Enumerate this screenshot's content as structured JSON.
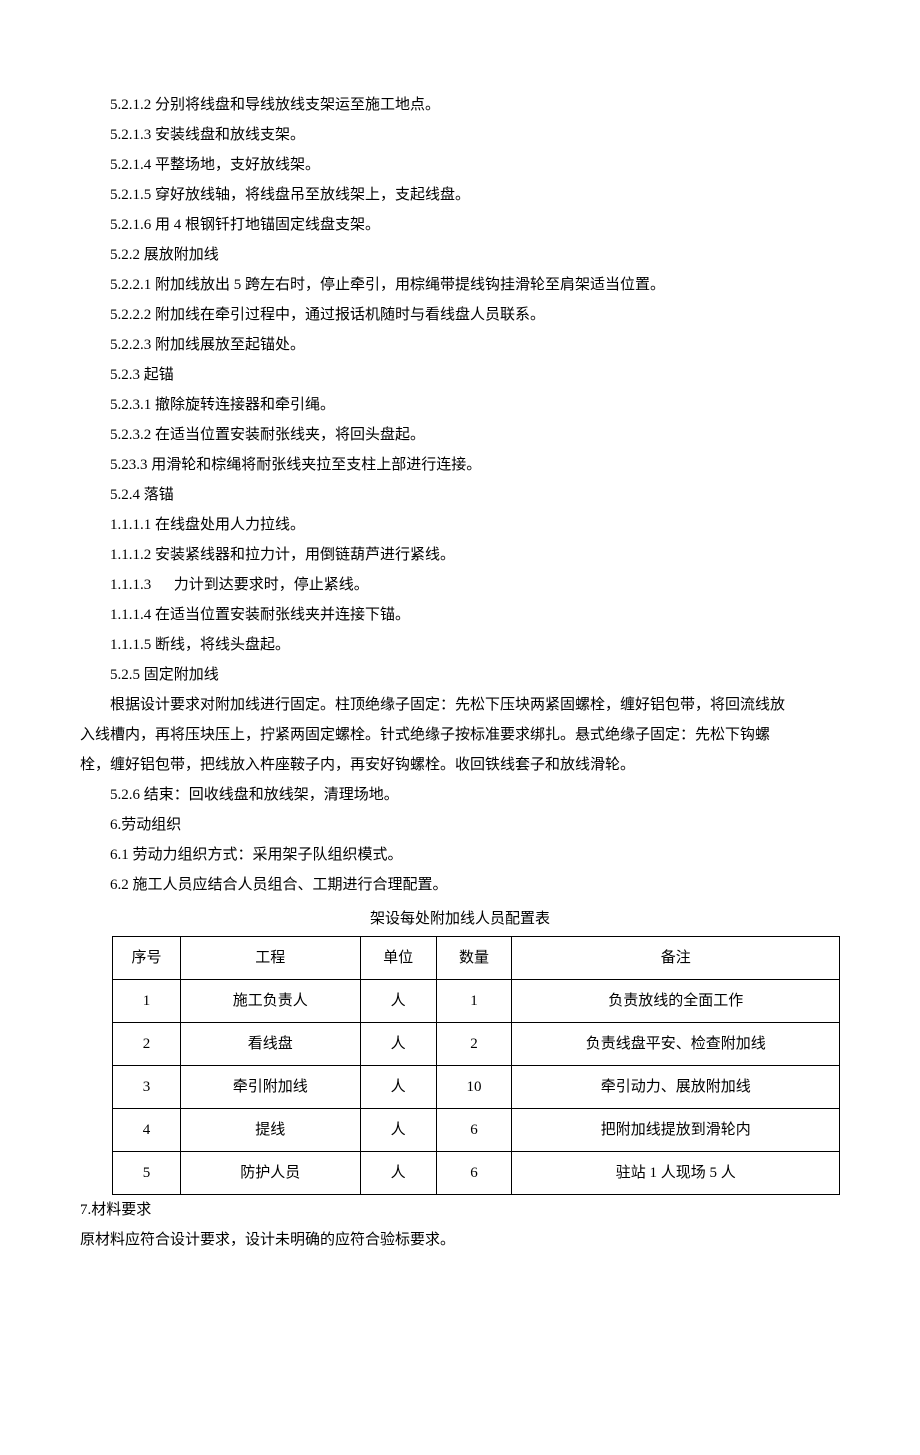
{
  "lines": [
    {
      "cls": "indent",
      "text": "5.2.1.2 分别将线盘和导线放线支架运至施工地点。"
    },
    {
      "cls": "indent",
      "text": "5.2.1.3 安装线盘和放线支架。"
    },
    {
      "cls": "indent",
      "text": "5.2.1.4 平整场地，支好放线架。"
    },
    {
      "cls": "indent",
      "text": "5.2.1.5 穿好放线轴，将线盘吊至放线架上，支起线盘。"
    },
    {
      "cls": "indent",
      "text": "5.2.1.6 用 4 根钢钎打地锚固定线盘支架。"
    },
    {
      "cls": "indent",
      "text": "5.2.2  展放附加线"
    },
    {
      "cls": "indent",
      "text": "5.2.2.1 附加线放出 5 跨左右时，停止牵引，用棕绳带提线钩挂滑轮至肩架适当位置。"
    },
    {
      "cls": "indent",
      "text": "5.2.2.2 附加线在牵引过程中，通过报话机随时与看线盘人员联系。"
    },
    {
      "cls": "indent",
      "text": "5.2.2.3 附加线展放至起锚处。"
    },
    {
      "cls": "indent",
      "text": "5.2.3  起锚"
    },
    {
      "cls": "indent",
      "text": "5.2.3.1 撤除旋转连接器和牵引绳。"
    },
    {
      "cls": "indent",
      "text": "5.2.3.2 在适当位置安装耐张线夹，将回头盘起。"
    },
    {
      "cls": "indent",
      "text": "5.23.3 用滑轮和棕绳将耐张线夹拉至支柱上部进行连接。"
    },
    {
      "cls": "indent",
      "text": "5.2.4 落锚"
    },
    {
      "cls": "indent",
      "text": "1.1.1.1 在线盘处用人力拉线。"
    },
    {
      "cls": "indent",
      "text": "1.1.1.2 安装紧线器和拉力计，用倒链葫芦进行紧线。"
    },
    {
      "cls": "indent",
      "text": "1.1.1.3 　 力计到达要求时，停止紧线。"
    },
    {
      "cls": "indent",
      "text": "1.1.1.4 在适当位置安装耐张线夹并连接下锚。"
    },
    {
      "cls": "indent",
      "text": "1.1.1.5 断线，将线头盘起。"
    },
    {
      "cls": "indent",
      "text": "5.2.5  固定附加线"
    },
    {
      "cls": "indent",
      "text": "根据设计要求对附加线进行固定。柱顶绝缘子固定：先松下压块两紧固螺栓，缠好铝包带，将回流线放"
    },
    {
      "cls": "noindent",
      "text": "入线槽内，再将压块压上，拧紧两固定螺栓。针式绝缘子按标准要求绑扎。悬式绝缘子固定：先松下钩螺"
    },
    {
      "cls": "noindent",
      "text": "栓，缠好铝包带，把线放入杵座鞍子内，再安好钩螺栓。收回铁线套子和放线滑轮。"
    },
    {
      "cls": "indent",
      "text": "5.2.6  结束：回收线盘和放线架，清理场地。"
    },
    {
      "cls": "indent",
      "text": "6.劳动组织"
    },
    {
      "cls": "indent",
      "text": "6.1  劳动力组织方式：采用架子队组织模式。"
    },
    {
      "cls": "indent",
      "text": "6.2  施工人员应结合人员组合、工期进行合理配置。"
    }
  ],
  "table_caption": "架设每处附加线人员配置表",
  "table": {
    "headers": [
      "序号",
      "工程",
      "单位",
      "数量",
      "备注"
    ],
    "rows": [
      [
        "1",
        "施工负责人",
        "人",
        "1",
        "负责放线的全面工作"
      ],
      [
        "2",
        "看线盘",
        "人",
        "2",
        "负责线盘平安、检查附加线"
      ],
      [
        "3",
        "牵引附加线",
        "人",
        "10",
        "牵引动力、展放附加线"
      ],
      [
        "4",
        "提线",
        "人",
        "6",
        "把附加线提放到滑轮内"
      ],
      [
        "5",
        "防护人员",
        "人",
        "6",
        "驻站 1 人现场 5 人"
      ]
    ]
  },
  "after_lines": [
    {
      "cls": "noindent",
      "text": "7.材料要求"
    },
    {
      "cls": "noindent",
      "text": "原材料应符合设计要求，设计未明确的应符合验标要求。"
    }
  ]
}
